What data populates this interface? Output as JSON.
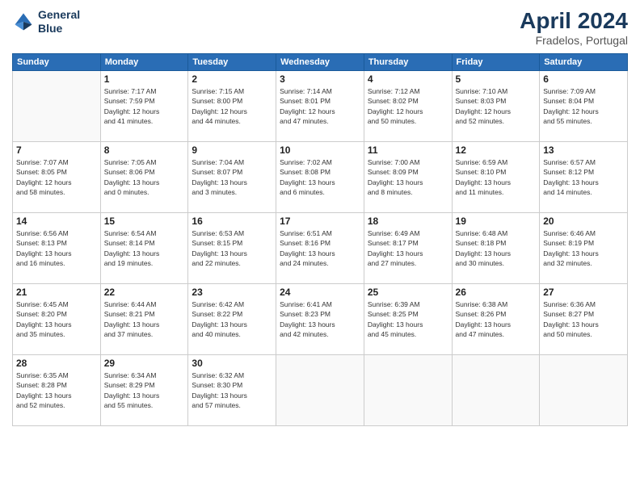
{
  "header": {
    "logo_line1": "General",
    "logo_line2": "Blue",
    "month": "April 2024",
    "location": "Fradelos, Portugal"
  },
  "weekdays": [
    "Sunday",
    "Monday",
    "Tuesday",
    "Wednesday",
    "Thursday",
    "Friday",
    "Saturday"
  ],
  "weeks": [
    [
      {
        "day": "",
        "info": ""
      },
      {
        "day": "1",
        "info": "Sunrise: 7:17 AM\nSunset: 7:59 PM\nDaylight: 12 hours\nand 41 minutes."
      },
      {
        "day": "2",
        "info": "Sunrise: 7:15 AM\nSunset: 8:00 PM\nDaylight: 12 hours\nand 44 minutes."
      },
      {
        "day": "3",
        "info": "Sunrise: 7:14 AM\nSunset: 8:01 PM\nDaylight: 12 hours\nand 47 minutes."
      },
      {
        "day": "4",
        "info": "Sunrise: 7:12 AM\nSunset: 8:02 PM\nDaylight: 12 hours\nand 50 minutes."
      },
      {
        "day": "5",
        "info": "Sunrise: 7:10 AM\nSunset: 8:03 PM\nDaylight: 12 hours\nand 52 minutes."
      },
      {
        "day": "6",
        "info": "Sunrise: 7:09 AM\nSunset: 8:04 PM\nDaylight: 12 hours\nand 55 minutes."
      }
    ],
    [
      {
        "day": "7",
        "info": "Sunrise: 7:07 AM\nSunset: 8:05 PM\nDaylight: 12 hours\nand 58 minutes."
      },
      {
        "day": "8",
        "info": "Sunrise: 7:05 AM\nSunset: 8:06 PM\nDaylight: 13 hours\nand 0 minutes."
      },
      {
        "day": "9",
        "info": "Sunrise: 7:04 AM\nSunset: 8:07 PM\nDaylight: 13 hours\nand 3 minutes."
      },
      {
        "day": "10",
        "info": "Sunrise: 7:02 AM\nSunset: 8:08 PM\nDaylight: 13 hours\nand 6 minutes."
      },
      {
        "day": "11",
        "info": "Sunrise: 7:00 AM\nSunset: 8:09 PM\nDaylight: 13 hours\nand 8 minutes."
      },
      {
        "day": "12",
        "info": "Sunrise: 6:59 AM\nSunset: 8:10 PM\nDaylight: 13 hours\nand 11 minutes."
      },
      {
        "day": "13",
        "info": "Sunrise: 6:57 AM\nSunset: 8:12 PM\nDaylight: 13 hours\nand 14 minutes."
      }
    ],
    [
      {
        "day": "14",
        "info": "Sunrise: 6:56 AM\nSunset: 8:13 PM\nDaylight: 13 hours\nand 16 minutes."
      },
      {
        "day": "15",
        "info": "Sunrise: 6:54 AM\nSunset: 8:14 PM\nDaylight: 13 hours\nand 19 minutes."
      },
      {
        "day": "16",
        "info": "Sunrise: 6:53 AM\nSunset: 8:15 PM\nDaylight: 13 hours\nand 22 minutes."
      },
      {
        "day": "17",
        "info": "Sunrise: 6:51 AM\nSunset: 8:16 PM\nDaylight: 13 hours\nand 24 minutes."
      },
      {
        "day": "18",
        "info": "Sunrise: 6:49 AM\nSunset: 8:17 PM\nDaylight: 13 hours\nand 27 minutes."
      },
      {
        "day": "19",
        "info": "Sunrise: 6:48 AM\nSunset: 8:18 PM\nDaylight: 13 hours\nand 30 minutes."
      },
      {
        "day": "20",
        "info": "Sunrise: 6:46 AM\nSunset: 8:19 PM\nDaylight: 13 hours\nand 32 minutes."
      }
    ],
    [
      {
        "day": "21",
        "info": "Sunrise: 6:45 AM\nSunset: 8:20 PM\nDaylight: 13 hours\nand 35 minutes."
      },
      {
        "day": "22",
        "info": "Sunrise: 6:44 AM\nSunset: 8:21 PM\nDaylight: 13 hours\nand 37 minutes."
      },
      {
        "day": "23",
        "info": "Sunrise: 6:42 AM\nSunset: 8:22 PM\nDaylight: 13 hours\nand 40 minutes."
      },
      {
        "day": "24",
        "info": "Sunrise: 6:41 AM\nSunset: 8:23 PM\nDaylight: 13 hours\nand 42 minutes."
      },
      {
        "day": "25",
        "info": "Sunrise: 6:39 AM\nSunset: 8:25 PM\nDaylight: 13 hours\nand 45 minutes."
      },
      {
        "day": "26",
        "info": "Sunrise: 6:38 AM\nSunset: 8:26 PM\nDaylight: 13 hours\nand 47 minutes."
      },
      {
        "day": "27",
        "info": "Sunrise: 6:36 AM\nSunset: 8:27 PM\nDaylight: 13 hours\nand 50 minutes."
      }
    ],
    [
      {
        "day": "28",
        "info": "Sunrise: 6:35 AM\nSunset: 8:28 PM\nDaylight: 13 hours\nand 52 minutes."
      },
      {
        "day": "29",
        "info": "Sunrise: 6:34 AM\nSunset: 8:29 PM\nDaylight: 13 hours\nand 55 minutes."
      },
      {
        "day": "30",
        "info": "Sunrise: 6:32 AM\nSunset: 8:30 PM\nDaylight: 13 hours\nand 57 minutes."
      },
      {
        "day": "",
        "info": ""
      },
      {
        "day": "",
        "info": ""
      },
      {
        "day": "",
        "info": ""
      },
      {
        "day": "",
        "info": ""
      }
    ]
  ]
}
